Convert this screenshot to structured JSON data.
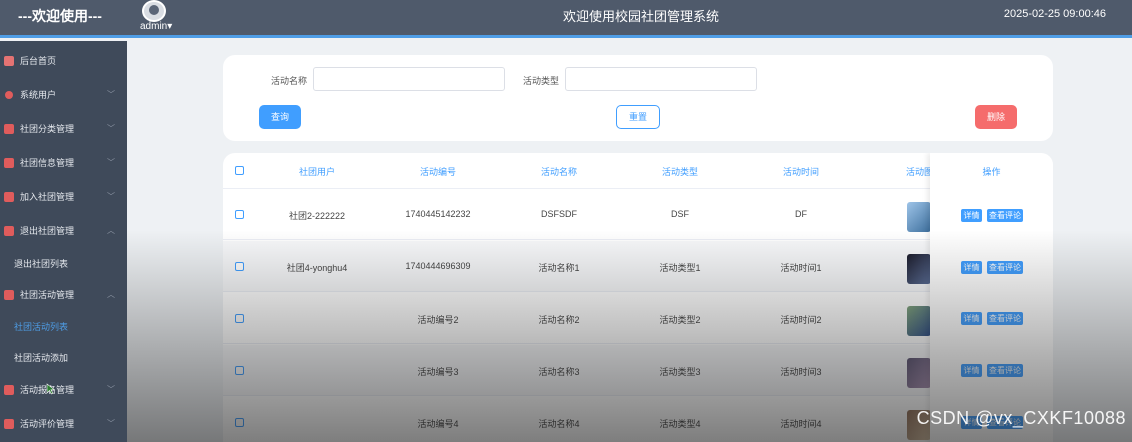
{
  "header": {
    "welcome": "---欢迎使用---",
    "user": "admin",
    "title": "欢迎使用校园社团管理系统",
    "datetime": "2025-02-25 09:00:46"
  },
  "sidebar": {
    "items": [
      {
        "label": "后台首页"
      },
      {
        "label": "系统用户"
      },
      {
        "label": "社团分类管理"
      },
      {
        "label": "社团信息管理"
      },
      {
        "label": "加入社团管理"
      },
      {
        "label": "退出社团管理"
      },
      {
        "label": "退出社团列表"
      },
      {
        "label": "社团活动管理"
      },
      {
        "label": "社团活动列表"
      },
      {
        "label": "社团活动添加"
      },
      {
        "label": "活动报名管理"
      },
      {
        "label": "活动评价管理"
      }
    ]
  },
  "search": {
    "name_label": "活动名称",
    "type_label": "活动类型",
    "search_btn": "查询",
    "reset_btn": "重置",
    "delete_btn": "删除"
  },
  "table": {
    "headers": [
      "社团用户",
      "活动编号",
      "活动名称",
      "活动类型",
      "活动时间",
      "活动图",
      "操作"
    ],
    "rows": [
      {
        "user": "社团2-222222",
        "code": "1740445142232",
        "name": "DSFSDF",
        "type": "DSF",
        "time": "DF"
      },
      {
        "user": "社团4-yonghu4",
        "code": "1740444696309",
        "name": "活动名称1",
        "type": "活动类型1",
        "time": "活动时间1"
      },
      {
        "user": "",
        "code": "活动编号2",
        "name": "活动名称2",
        "type": "活动类型2",
        "time": "活动时间2"
      },
      {
        "user": "",
        "code": "活动编号3",
        "name": "活动名称3",
        "type": "活动类型3",
        "time": "活动时间3"
      },
      {
        "user": "",
        "code": "活动编号4",
        "name": "活动名称4",
        "type": "活动类型4",
        "time": "活动时间4"
      }
    ],
    "detail_btn": "详情",
    "review_btn": "查看评论"
  },
  "watermark": "CSDN @vx_CXKF10088",
  "colors": {
    "primary": "#409eff",
    "danger": "#f56c6c",
    "sidebar": "#3f4a5a",
    "header": "#4f5a6b"
  }
}
